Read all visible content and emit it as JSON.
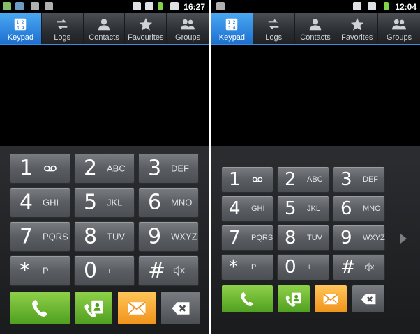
{
  "left": {
    "clock": "16:27",
    "tabs": [
      {
        "label": "Keypad",
        "icon": "keypad-icon",
        "active": true
      },
      {
        "label": "Logs",
        "icon": "logs-icon",
        "active": false
      },
      {
        "label": "Contacts",
        "icon": "contacts-icon",
        "active": false
      },
      {
        "label": "Favourites",
        "icon": "star-icon",
        "active": false
      },
      {
        "label": "Groups",
        "icon": "groups-icon",
        "active": false
      }
    ]
  },
  "right": {
    "clock": "12:04",
    "tabs": [
      {
        "label": "Keypad",
        "icon": "keypad-icon",
        "active": true
      },
      {
        "label": "Logs",
        "icon": "logs-icon",
        "active": false
      },
      {
        "label": "Contacts",
        "icon": "contacts-icon",
        "active": false
      },
      {
        "label": "Favorites",
        "icon": "star-icon",
        "active": false
      },
      {
        "label": "Groups",
        "icon": "groups-icon",
        "active": false
      }
    ]
  },
  "keys": [
    {
      "digit": "1",
      "letters": "",
      "icon": "voicemail-icon"
    },
    {
      "digit": "2",
      "letters": "ABC"
    },
    {
      "digit": "3",
      "letters": "DEF"
    },
    {
      "digit": "4",
      "letters": "GHI"
    },
    {
      "digit": "5",
      "letters": "JKL"
    },
    {
      "digit": "6",
      "letters": "MNO"
    },
    {
      "digit": "7",
      "letters": "PQRS"
    },
    {
      "digit": "8",
      "letters": "TUV"
    },
    {
      "digit": "9",
      "letters": "WXYZ"
    },
    {
      "digit": "*",
      "letters": "P"
    },
    {
      "digit": "0",
      "letters": "+"
    },
    {
      "digit": "#",
      "letters": "",
      "icon": "mute-icon"
    }
  ],
  "actions": [
    {
      "name": "call-button",
      "icon": "phone-icon",
      "color": "#5fb02a"
    },
    {
      "name": "contacts-call-button",
      "icon": "contact-card-icon",
      "color": "#5fb02a"
    },
    {
      "name": "message-button",
      "icon": "envelope-icon",
      "color": "#f5a623"
    },
    {
      "name": "backspace-button",
      "icon": "backspace-icon",
      "color": "#5a5d61"
    }
  ],
  "colors": {
    "accent": "#2b86e0",
    "pad_background": "#242629"
  }
}
